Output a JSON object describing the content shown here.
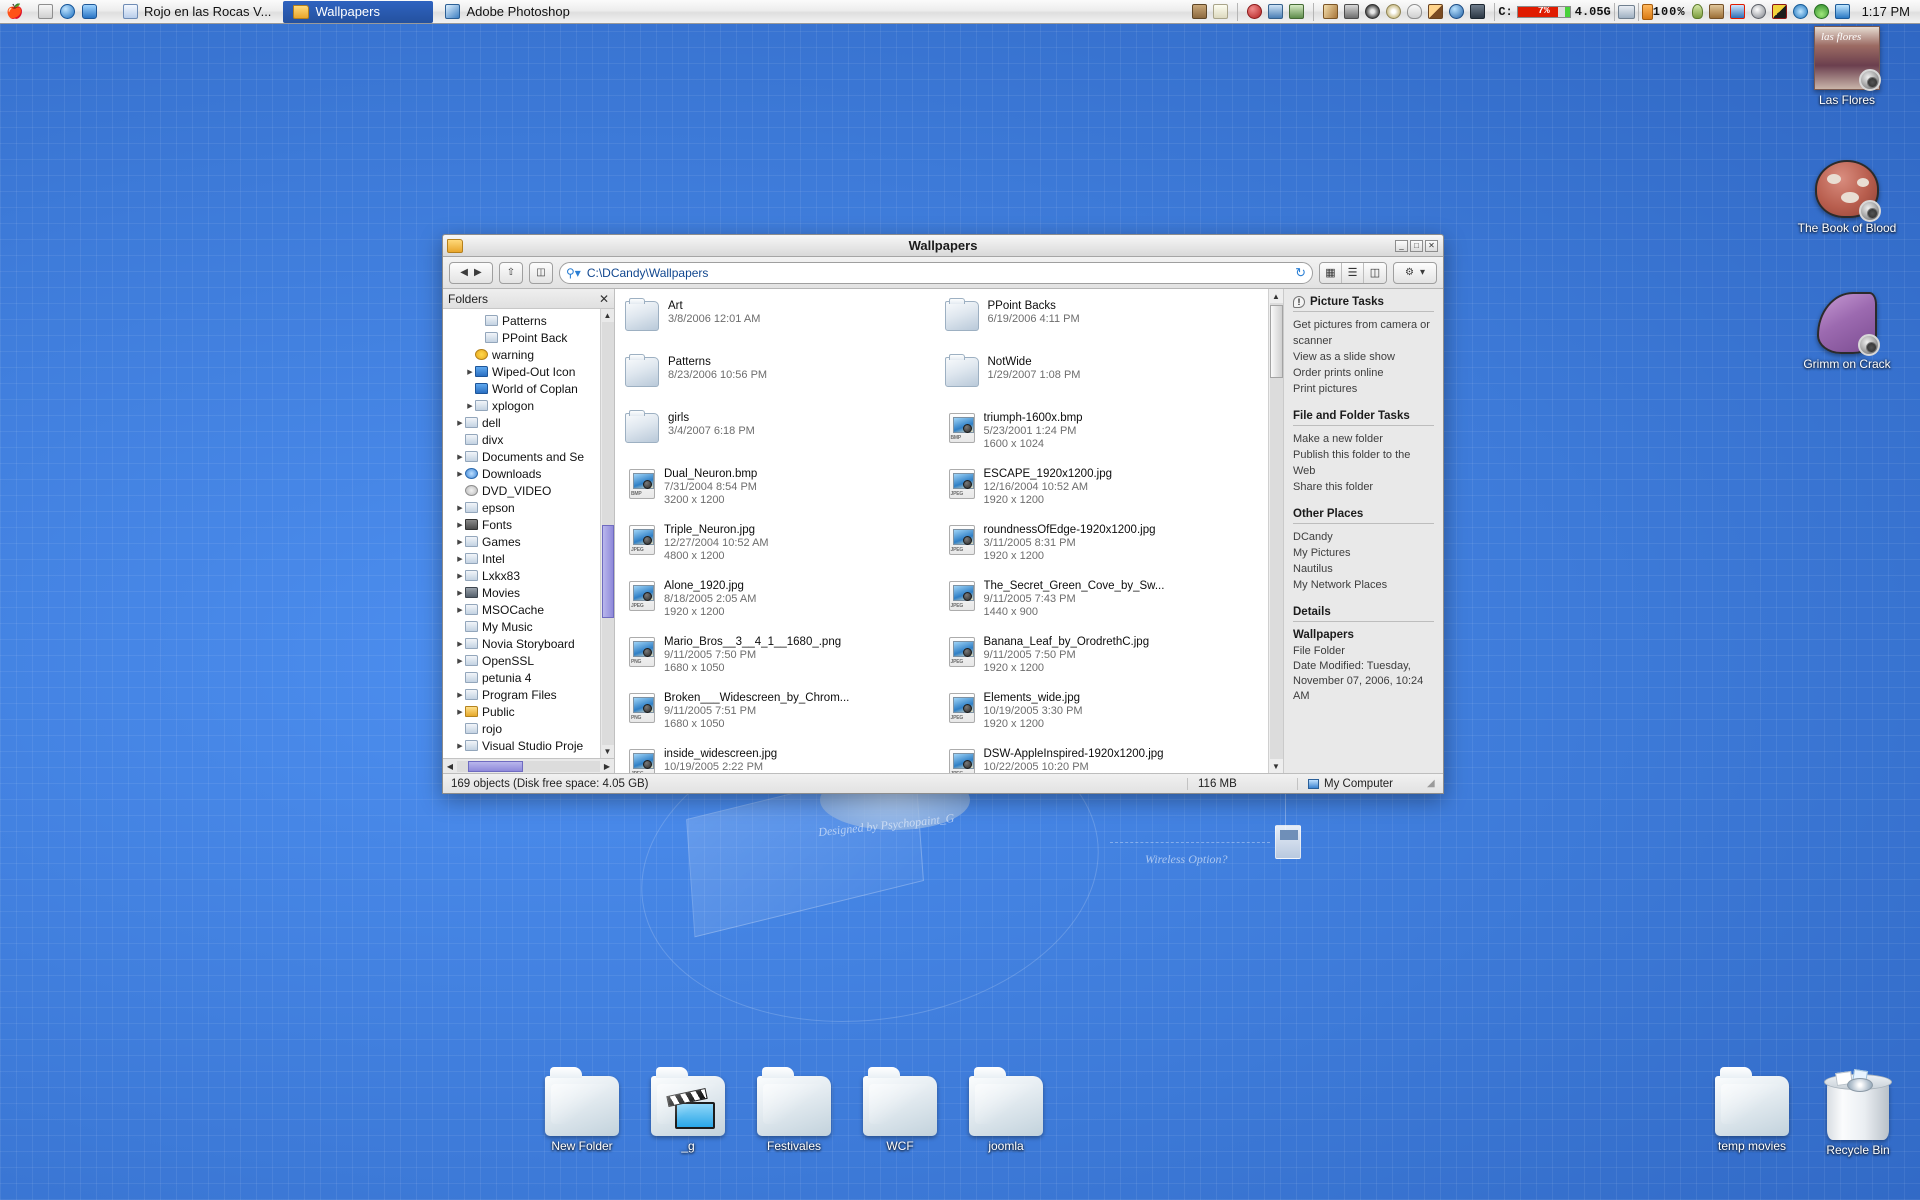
{
  "taskbar": {
    "apple_icon": "apple-icon",
    "quick_launch": [
      "show-desktop-icon",
      "internet-explorer-icon",
      "refresh-browser-icon"
    ],
    "tasks": [
      {
        "label": "Rojo en las Rocas V...",
        "icon": "word-document-icon",
        "active": false
      },
      {
        "label": "Wallpapers",
        "icon": "folder-icon",
        "active": true
      },
      {
        "label": "Adobe Photoshop",
        "icon": "photoshop-icon",
        "active": false
      }
    ],
    "tray_icons": [
      "book-icon",
      "envelope-icon",
      "ball-icon",
      "monitor-pen-icon",
      "notebook-pen-icon",
      "brush-icon",
      "plane-icon",
      "film-reel-icon",
      "disc-icon",
      "skull-icon",
      "paint-icon",
      "globe-icon",
      "laptop-icon"
    ],
    "disk_meter": {
      "label": "C:",
      "percent": "7%",
      "free": "4.05G"
    },
    "monitor_icon": "monitor-icon",
    "battery_icon": "battery-icon",
    "battery_percent": "100%",
    "tray_icons_2": [
      "user-icon",
      "animal-icon",
      "volume-mute-icon",
      "swirl-icon",
      "colors-icon",
      "gear-blue-icon",
      "wireless-icon",
      "messenger-icon"
    ],
    "clock": "1:17 PM"
  },
  "window": {
    "title": "Wallpapers",
    "title_icon": "folder-icon",
    "window_buttons": [
      "minimize",
      "maximize",
      "close"
    ],
    "toolbar": {
      "back_icon": "back-arrow-icon",
      "forward_icon": "forward-arrow-icon",
      "up_icon": "up-arrow-icon",
      "folders_icon": "folders-pane-icon",
      "address_label": "C:\\DCandy\\Wallpapers",
      "search_icon": "search-icon",
      "refresh_icon": "refresh-icon",
      "view_icons": [
        "thumbnails-view-icon",
        "list-view-icon",
        "details-view-icon"
      ],
      "options_icon": "gear-icon",
      "options_caret": "▾"
    },
    "folders_pane": {
      "header": "Folders",
      "close_icon": "close-icon",
      "items": [
        {
          "label": "Patterns",
          "indent": 5,
          "arrow": false,
          "icon": "folder"
        },
        {
          "label": "PPoint Back",
          "indent": 5,
          "arrow": false,
          "icon": "folder"
        },
        {
          "label": "warning",
          "indent": 4,
          "arrow": false,
          "icon": "warn"
        },
        {
          "label": "Wiped-Out Icon",
          "indent": 4,
          "arrow": true,
          "icon": "blue"
        },
        {
          "label": "World of Coplan",
          "indent": 4,
          "arrow": false,
          "icon": "blue"
        },
        {
          "label": "xplogon",
          "indent": 4,
          "arrow": true,
          "icon": "folder"
        },
        {
          "label": "dell",
          "indent": 3,
          "arrow": true,
          "icon": "folder"
        },
        {
          "label": "divx",
          "indent": 3,
          "arrow": false,
          "icon": "folder"
        },
        {
          "label": "Documents and Se",
          "indent": 3,
          "arrow": true,
          "icon": "folder"
        },
        {
          "label": "Downloads",
          "indent": 3,
          "arrow": true,
          "icon": "net"
        },
        {
          "label": "DVD_VIDEO",
          "indent": 3,
          "arrow": false,
          "icon": "cd"
        },
        {
          "label": "epson",
          "indent": 3,
          "arrow": true,
          "icon": "folder"
        },
        {
          "label": "Fonts",
          "indent": 3,
          "arrow": true,
          "icon": "fonts"
        },
        {
          "label": "Games",
          "indent": 3,
          "arrow": true,
          "icon": "folder"
        },
        {
          "label": "Intel",
          "indent": 3,
          "arrow": true,
          "icon": "folder"
        },
        {
          "label": "Lxkx83",
          "indent": 3,
          "arrow": true,
          "icon": "folder"
        },
        {
          "label": "Movies",
          "indent": 3,
          "arrow": true,
          "icon": "mov"
        },
        {
          "label": "MSOCache",
          "indent": 3,
          "arrow": true,
          "icon": "folder"
        },
        {
          "label": "My Music",
          "indent": 3,
          "arrow": false,
          "icon": "folder"
        },
        {
          "label": "Novia Storyboard",
          "indent": 3,
          "arrow": true,
          "icon": "folder"
        },
        {
          "label": "OpenSSL",
          "indent": 3,
          "arrow": true,
          "icon": "folder"
        },
        {
          "label": "petunia 4",
          "indent": 3,
          "arrow": false,
          "icon": "folder"
        },
        {
          "label": "Program Files",
          "indent": 3,
          "arrow": true,
          "icon": "folder"
        },
        {
          "label": "Public",
          "indent": 3,
          "arrow": true,
          "icon": "pub"
        },
        {
          "label": "rojo",
          "indent": 3,
          "arrow": false,
          "icon": "folder"
        },
        {
          "label": "Visual Studio Proje",
          "indent": 3,
          "arrow": true,
          "icon": "folder"
        }
      ]
    },
    "files": [
      {
        "name": "Art",
        "date": "3/8/2006 12:01 AM",
        "dim": "",
        "type": "folder"
      },
      {
        "name": "PPoint Backs",
        "date": "6/19/2006 4:11 PM",
        "dim": "",
        "type": "folder"
      },
      {
        "name": "Patterns",
        "date": "8/23/2006 10:56 PM",
        "dim": "",
        "type": "folder"
      },
      {
        "name": "NotWide",
        "date": "1/29/2007 1:08 PM",
        "dim": "",
        "type": "folder"
      },
      {
        "name": "girls",
        "date": "3/4/2007 6:18 PM",
        "dim": "",
        "type": "folder"
      },
      {
        "name": "triumph-1600x.bmp",
        "date": "5/23/2001 1:24 PM",
        "dim": "1600 x 1024",
        "type": "BMP"
      },
      {
        "name": "Dual_Neuron.bmp",
        "date": "7/31/2004 8:54 PM",
        "dim": "3200 x 1200",
        "type": "BMP"
      },
      {
        "name": "ESCAPE_1920x1200.jpg",
        "date": "12/16/2004 10:52 AM",
        "dim": "1920 x 1200",
        "type": "JPEG"
      },
      {
        "name": "Triple_Neuron.jpg",
        "date": "12/27/2004 10:52 AM",
        "dim": "4800 x 1200",
        "type": "JPEG"
      },
      {
        "name": "roundnessOfEdge-1920x1200.jpg",
        "date": "3/11/2005 8:31 PM",
        "dim": "1920 x 1200",
        "type": "JPEG"
      },
      {
        "name": "Alone_1920.jpg",
        "date": "8/18/2005 2:05 AM",
        "dim": "1920 x 1200",
        "type": "JPEG"
      },
      {
        "name": "The_Secret_Green_Cove_by_Sw...",
        "date": "9/11/2005 7:43 PM",
        "dim": "1440 x 900",
        "type": "JPEG"
      },
      {
        "name": "Mario_Bros__3__4_1__1680_.png",
        "date": "9/11/2005 7:50 PM",
        "dim": "1680 x 1050",
        "type": "PNG"
      },
      {
        "name": "Banana_Leaf_by_OrodrethC.jpg",
        "date": "9/11/2005 7:50 PM",
        "dim": "1920 x 1200",
        "type": "JPEG"
      },
      {
        "name": "Broken___Widescreen_by_Chrom...",
        "date": "9/11/2005 7:51 PM",
        "dim": "1680 x 1050",
        "type": "PNG"
      },
      {
        "name": "Elements_wide.jpg",
        "date": "10/19/2005 3:30 PM",
        "dim": "1920 x 1200",
        "type": "JPEG"
      },
      {
        "name": "inside_widescreen.jpg",
        "date": "10/19/2005 2:22 PM",
        "dim": "",
        "type": "JPEG"
      },
      {
        "name": "DSW-AppleInspired-1920x1200.jpg",
        "date": "10/22/2005 10:20 PM",
        "dim": "",
        "type": "JPEG"
      }
    ],
    "task_pane": {
      "picture_tasks_title": "Picture Tasks",
      "picture_tasks": [
        "Get pictures from camera or scanner",
        "View as a slide show",
        "Order prints online",
        "Print pictures"
      ],
      "file_tasks_title": "File and Folder Tasks",
      "file_tasks": [
        "Make a new folder",
        "Publish this folder to the Web",
        "Share this folder"
      ],
      "other_places_title": "Other Places",
      "other_places": [
        "DCandy",
        "My Pictures",
        "Nautilus",
        "My Network Places"
      ],
      "details_title": "Details",
      "details_name": "Wallpapers",
      "details_type": "File Folder",
      "details_modified": "Date Modified: Tuesday, November 07, 2006, 10:24 AM"
    },
    "status": {
      "objects": "169 objects (Disk free space: 4.05 GB)",
      "size": "116 MB",
      "location": "My Computer"
    }
  },
  "desktop": {
    "wallpaper_texts": [
      "Designed by Psychopaint_G",
      "Wireless Option?"
    ],
    "icons_right": [
      {
        "label": "Las Flores",
        "art": "flores",
        "badge": "speaker-badge"
      },
      {
        "label": "The Book of Blood",
        "art": "mush",
        "badge": "speaker-badge"
      },
      {
        "label": "Grimm on Crack",
        "art": "hat",
        "badge": "speaker-badge"
      }
    ],
    "icons_bottom": [
      {
        "label": "New Folder",
        "art": "folder"
      },
      {
        "label": "_g",
        "art": "folder-movie"
      },
      {
        "label": "Festivales",
        "art": "folder"
      },
      {
        "label": "WCF",
        "art": "folder"
      },
      {
        "label": "joomla",
        "art": "folder"
      }
    ],
    "icons_bottom_right": [
      {
        "label": "temp movies",
        "art": "folder"
      },
      {
        "label": "Recycle Bin",
        "art": "recycle"
      }
    ]
  }
}
